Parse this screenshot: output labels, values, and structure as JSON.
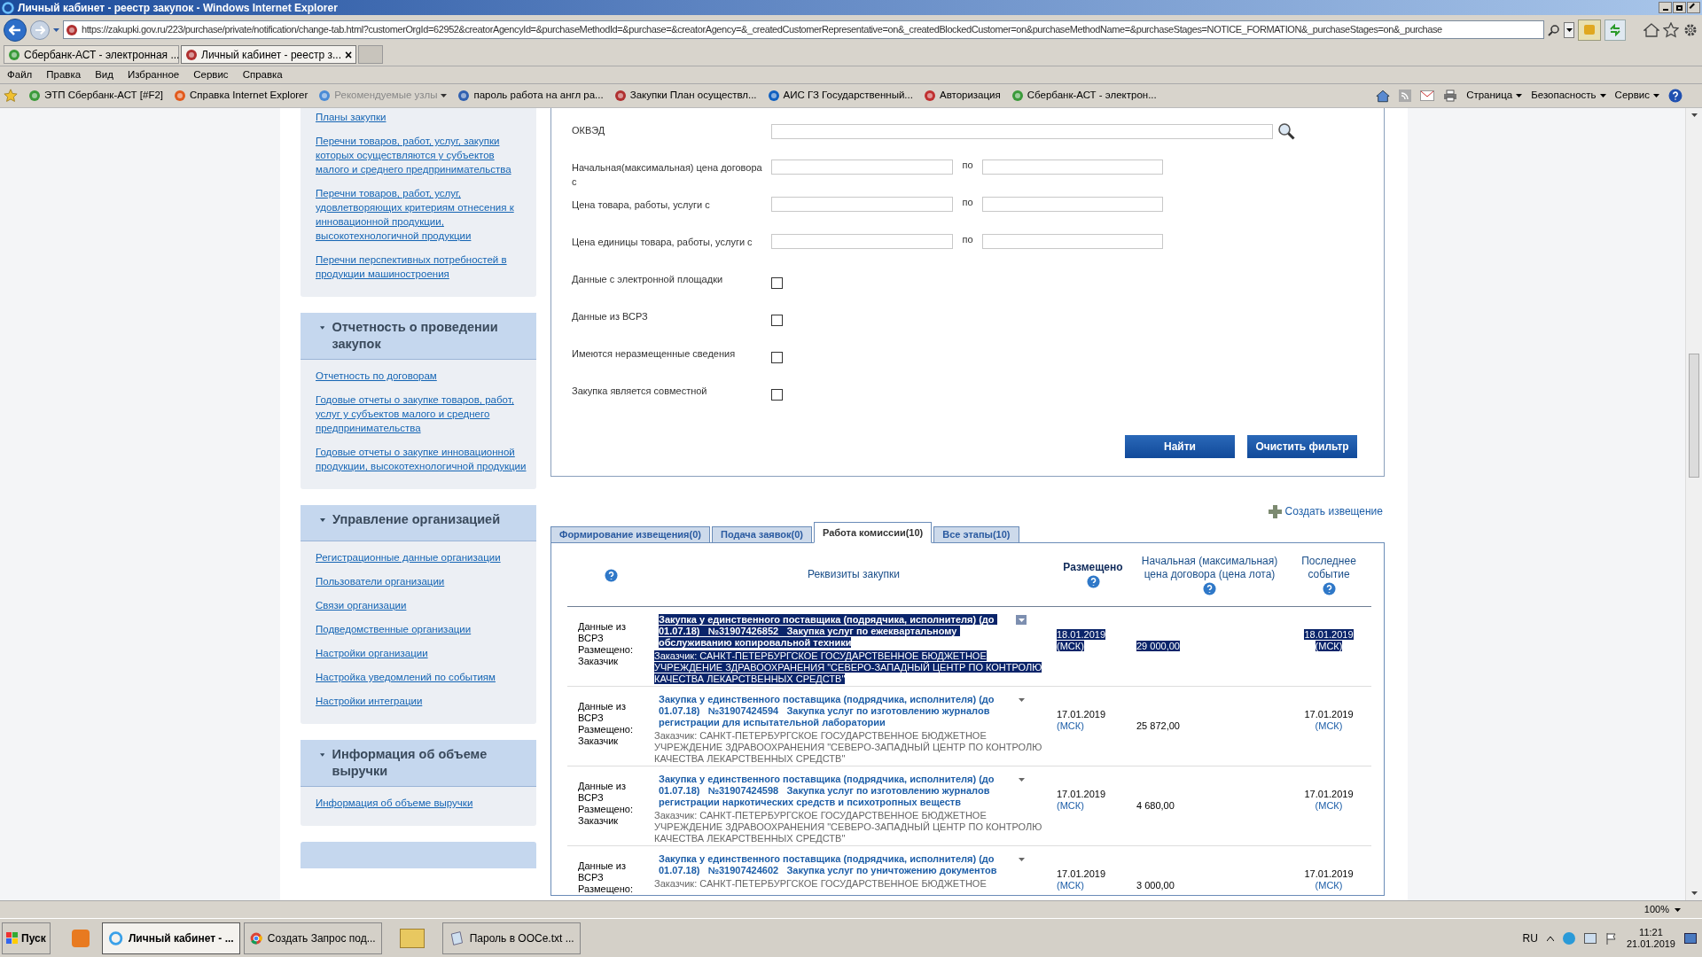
{
  "window": {
    "title": "Личный кабинет - реестр закупок - Windows Internet Explorer"
  },
  "address_bar": {
    "url": "https://zakupki.gov.ru/223/purchase/private/notification/change-tab.html?customerOrgId=62952&creatorAgencyId=&purchaseMethodId=&purchase=&creatorAgency=&_createdCustomerRepresentative=on&_createdBlockedCustomer=on&purchaseMethodName=&purchaseStages=NOTICE_FORMATION&_purchaseStages=on&_purchase"
  },
  "browser_tabs": [
    {
      "label": "Сбербанк-АСТ - электронная ...",
      "selected": false
    },
    {
      "label": "Личный кабинет - реестр з...",
      "selected": true,
      "close": "×"
    }
  ],
  "menu": [
    "Файл",
    "Правка",
    "Вид",
    "Избранное",
    "Сервис",
    "Справка"
  ],
  "favorites": [
    {
      "label": "ЭТП Сбербанк-АСТ [#F2]",
      "kind": "link"
    },
    {
      "label": "Справка Internet Explorer",
      "kind": "link"
    },
    {
      "label": "Рекомендуемые узлы",
      "kind": "dropdown"
    },
    {
      "label": "пароль работа на англ ра...",
      "kind": "link"
    },
    {
      "label": "Закупки  План осуществл...",
      "kind": "link"
    },
    {
      "label": "АИС ГЗ  Государственный...",
      "kind": "link"
    },
    {
      "label": "Авторизация",
      "kind": "link"
    },
    {
      "label": "Сбербанк-АСТ - электрон...",
      "kind": "link"
    }
  ],
  "command_bar": [
    "Страница",
    "Безопасность",
    "Сервис"
  ],
  "sidebar": [
    {
      "links": [
        "Планы закупки",
        "Перечни товаров, работ, услуг, закупки которых осуществляются у субъектов малого и среднего предпринимательства",
        "Перечни товаров, работ, услуг, удовлетворяющих критериям отнесения к инновационной продукции, высокотехнологичной продукции",
        "Перечни перспективных потребностей в продукции машиностроения"
      ]
    },
    {
      "title": "Отчетность о проведении закупок",
      "expanded": true,
      "links": [
        "Отчетность по договорам",
        "Годовые отчеты о закупке товаров, работ, услуг у субъектов малого и среднего предпринимательства",
        "Годовые отчеты о закупке инновационной продукции, высокотехнологичной продукции"
      ]
    },
    {
      "title": "Управление организацией",
      "expanded": true,
      "links": [
        "Регистрационные данные организации",
        "Пользователи организации",
        "Связи организации",
        "Подведомственные организации",
        "Настройки организации",
        "Настройка уведомлений по событиям",
        "Настройки интеграции"
      ]
    },
    {
      "title": "Информация об объеме выручки",
      "expanded": true,
      "links": [
        "Информация об объеме выручки"
      ]
    }
  ],
  "filter": {
    "fields": [
      {
        "kind": "lookup",
        "label": "ОКВЭД"
      },
      {
        "kind": "range",
        "label": "Начальная(максимальная) цена договора с",
        "separator": "по"
      },
      {
        "kind": "range",
        "label": "Цена товара, работы, услуги с",
        "separator": "по"
      },
      {
        "kind": "range",
        "label": "Цена единицы товара, работы, услуги с",
        "separator": "по"
      },
      {
        "kind": "checkbox",
        "label": "Данные с электронной площадки",
        "checked": false
      },
      {
        "kind": "checkbox",
        "label": "Данные из ВСРЗ",
        "checked": false
      },
      {
        "kind": "checkbox",
        "label": "Имеются неразмещенные сведения",
        "checked": false
      },
      {
        "kind": "checkbox",
        "label": "Закупка является совместной",
        "checked": false
      }
    ],
    "buttons": [
      "Найти",
      "Очистить фильтр"
    ]
  },
  "create_link": "Создать извещение",
  "stage_tabs": [
    {
      "label": "Формирование извещения(0)",
      "selected": false
    },
    {
      "label": "Подача заявок(0)",
      "selected": false
    },
    {
      "label": "Работа комиссии(10)",
      "selected": true
    },
    {
      "label": "Все этапы(10)",
      "selected": false
    }
  ],
  "table": {
    "columns": [
      {
        "help": true
      },
      {
        "label": "Реквизиты закупки",
        "help": false
      },
      {
        "label": "Размещено",
        "help": true
      },
      {
        "label": "Начальная (максимальная) цена договора (цена лота)",
        "help": true
      },
      {
        "label": "Последнее событие",
        "help": true
      }
    ],
    "rows": [
      {
        "selected": true,
        "info_lines": [
          "Данные из",
          "ВСРЗ",
          "Размещено:",
          "Заказчик"
        ],
        "title": "Закупка у единственного поставщика (подрядчика, исполнителя) (до 01.07.18)   №31907426852   Закупка услуг по ежеквартальному обслуживанию копировальной техники",
        "customer": "Заказчик:  САНКТ-ПЕТЕРБУРГСКОЕ ГОСУДАРСТВЕННОЕ БЮДЖЕТНОЕ УЧРЕЖДЕНИЕ ЗДРАВООХРАНЕНИЯ \"СЕВЕРО-ЗАПАДНЫЙ ЦЕНТР ПО КОНТРОЛЮ КАЧЕСТВА ЛЕКАРСТВЕННЫХ СРЕДСТВ\"",
        "placed": "18.01.2019",
        "placed_tz": "(МСК)",
        "price": "29 000,00",
        "last_event": "18.01.2019",
        "last_event_tz": "(МСК)"
      },
      {
        "selected": false,
        "info_lines": [
          "Данные из",
          "ВСРЗ",
          "Размещено:",
          "Заказчик"
        ],
        "title": "Закупка у единственного поставщика (подрядчика, исполнителя) (до 01.07.18)   №31907424594   Закупка услуг по изготовлению журналов регистрации для испытательной лаборатории",
        "customer": "Заказчик:  САНКТ-ПЕТЕРБУРГСКОЕ ГОСУДАРСТВЕННОЕ БЮДЖЕТНОЕ УЧРЕЖДЕНИЕ ЗДРАВООХРАНЕНИЯ \"СЕВЕРО-ЗАПАДНЫЙ ЦЕНТР ПО КОНТРОЛЮ КАЧЕСТВА ЛЕКАРСТВЕННЫХ СРЕДСТВ\"",
        "placed": "17.01.2019",
        "placed_tz": "(МСК)",
        "price": "25 872,00",
        "last_event": "17.01.2019",
        "last_event_tz": "(МСК)"
      },
      {
        "selected": false,
        "info_lines": [
          "Данные из",
          "ВСРЗ",
          "Размещено:",
          "Заказчик"
        ],
        "title": "Закупка у единственного поставщика (подрядчика, исполнителя) (до 01.07.18)   №31907424598   Закупка услуг по изготовлению журналов регистрации наркотических средств и психотропных веществ",
        "customer": "Заказчик:  САНКТ-ПЕТЕРБУРГСКОЕ ГОСУДАРСТВЕННОЕ БЮДЖЕТНОЕ УЧРЕЖДЕНИЕ ЗДРАВООХРАНЕНИЯ \"СЕВЕРО-ЗАПАДНЫЙ ЦЕНТР ПО КОНТРОЛЮ КАЧЕСТВА ЛЕКАРСТВЕННЫХ СРЕДСТВ\"",
        "placed": "17.01.2019",
        "placed_tz": "(МСК)",
        "price": "4 680,00",
        "last_event": "17.01.2019",
        "last_event_tz": "(МСК)"
      },
      {
        "selected": false,
        "info_lines": [
          "Данные из",
          "ВСРЗ",
          "Размещено:"
        ],
        "title": "Закупка у единственного поставщика (подрядчика, исполнителя) (до 01.07.18)   №31907424602   Закупка услуг по уничтожению документов",
        "customer": "Заказчик:  САНКТ-ПЕТЕРБУРГСКОЕ ГОСУДАРСТВЕННОЕ БЮДЖЕТНОЕ",
        "placed": "17.01.2019",
        "placed_tz": "(МСК)",
        "price": "3 000,00",
        "last_event": "17.01.2019",
        "last_event_tz": "(МСК)"
      }
    ]
  },
  "status_bar": {
    "zoom": "100%"
  },
  "taskbar": {
    "start": "Пуск",
    "items": [
      {
        "label": "Личный кабинет - ...",
        "selected": true,
        "kind": "browser"
      },
      {
        "label": "Создать Запрос под...",
        "selected": false,
        "kind": "chrome"
      },
      {
        "label": "Пароль в OOCe.txt ...",
        "selected": false,
        "kind": "notepad"
      }
    ],
    "language": "RU",
    "time": "11:21",
    "date": "21.01.2019"
  }
}
